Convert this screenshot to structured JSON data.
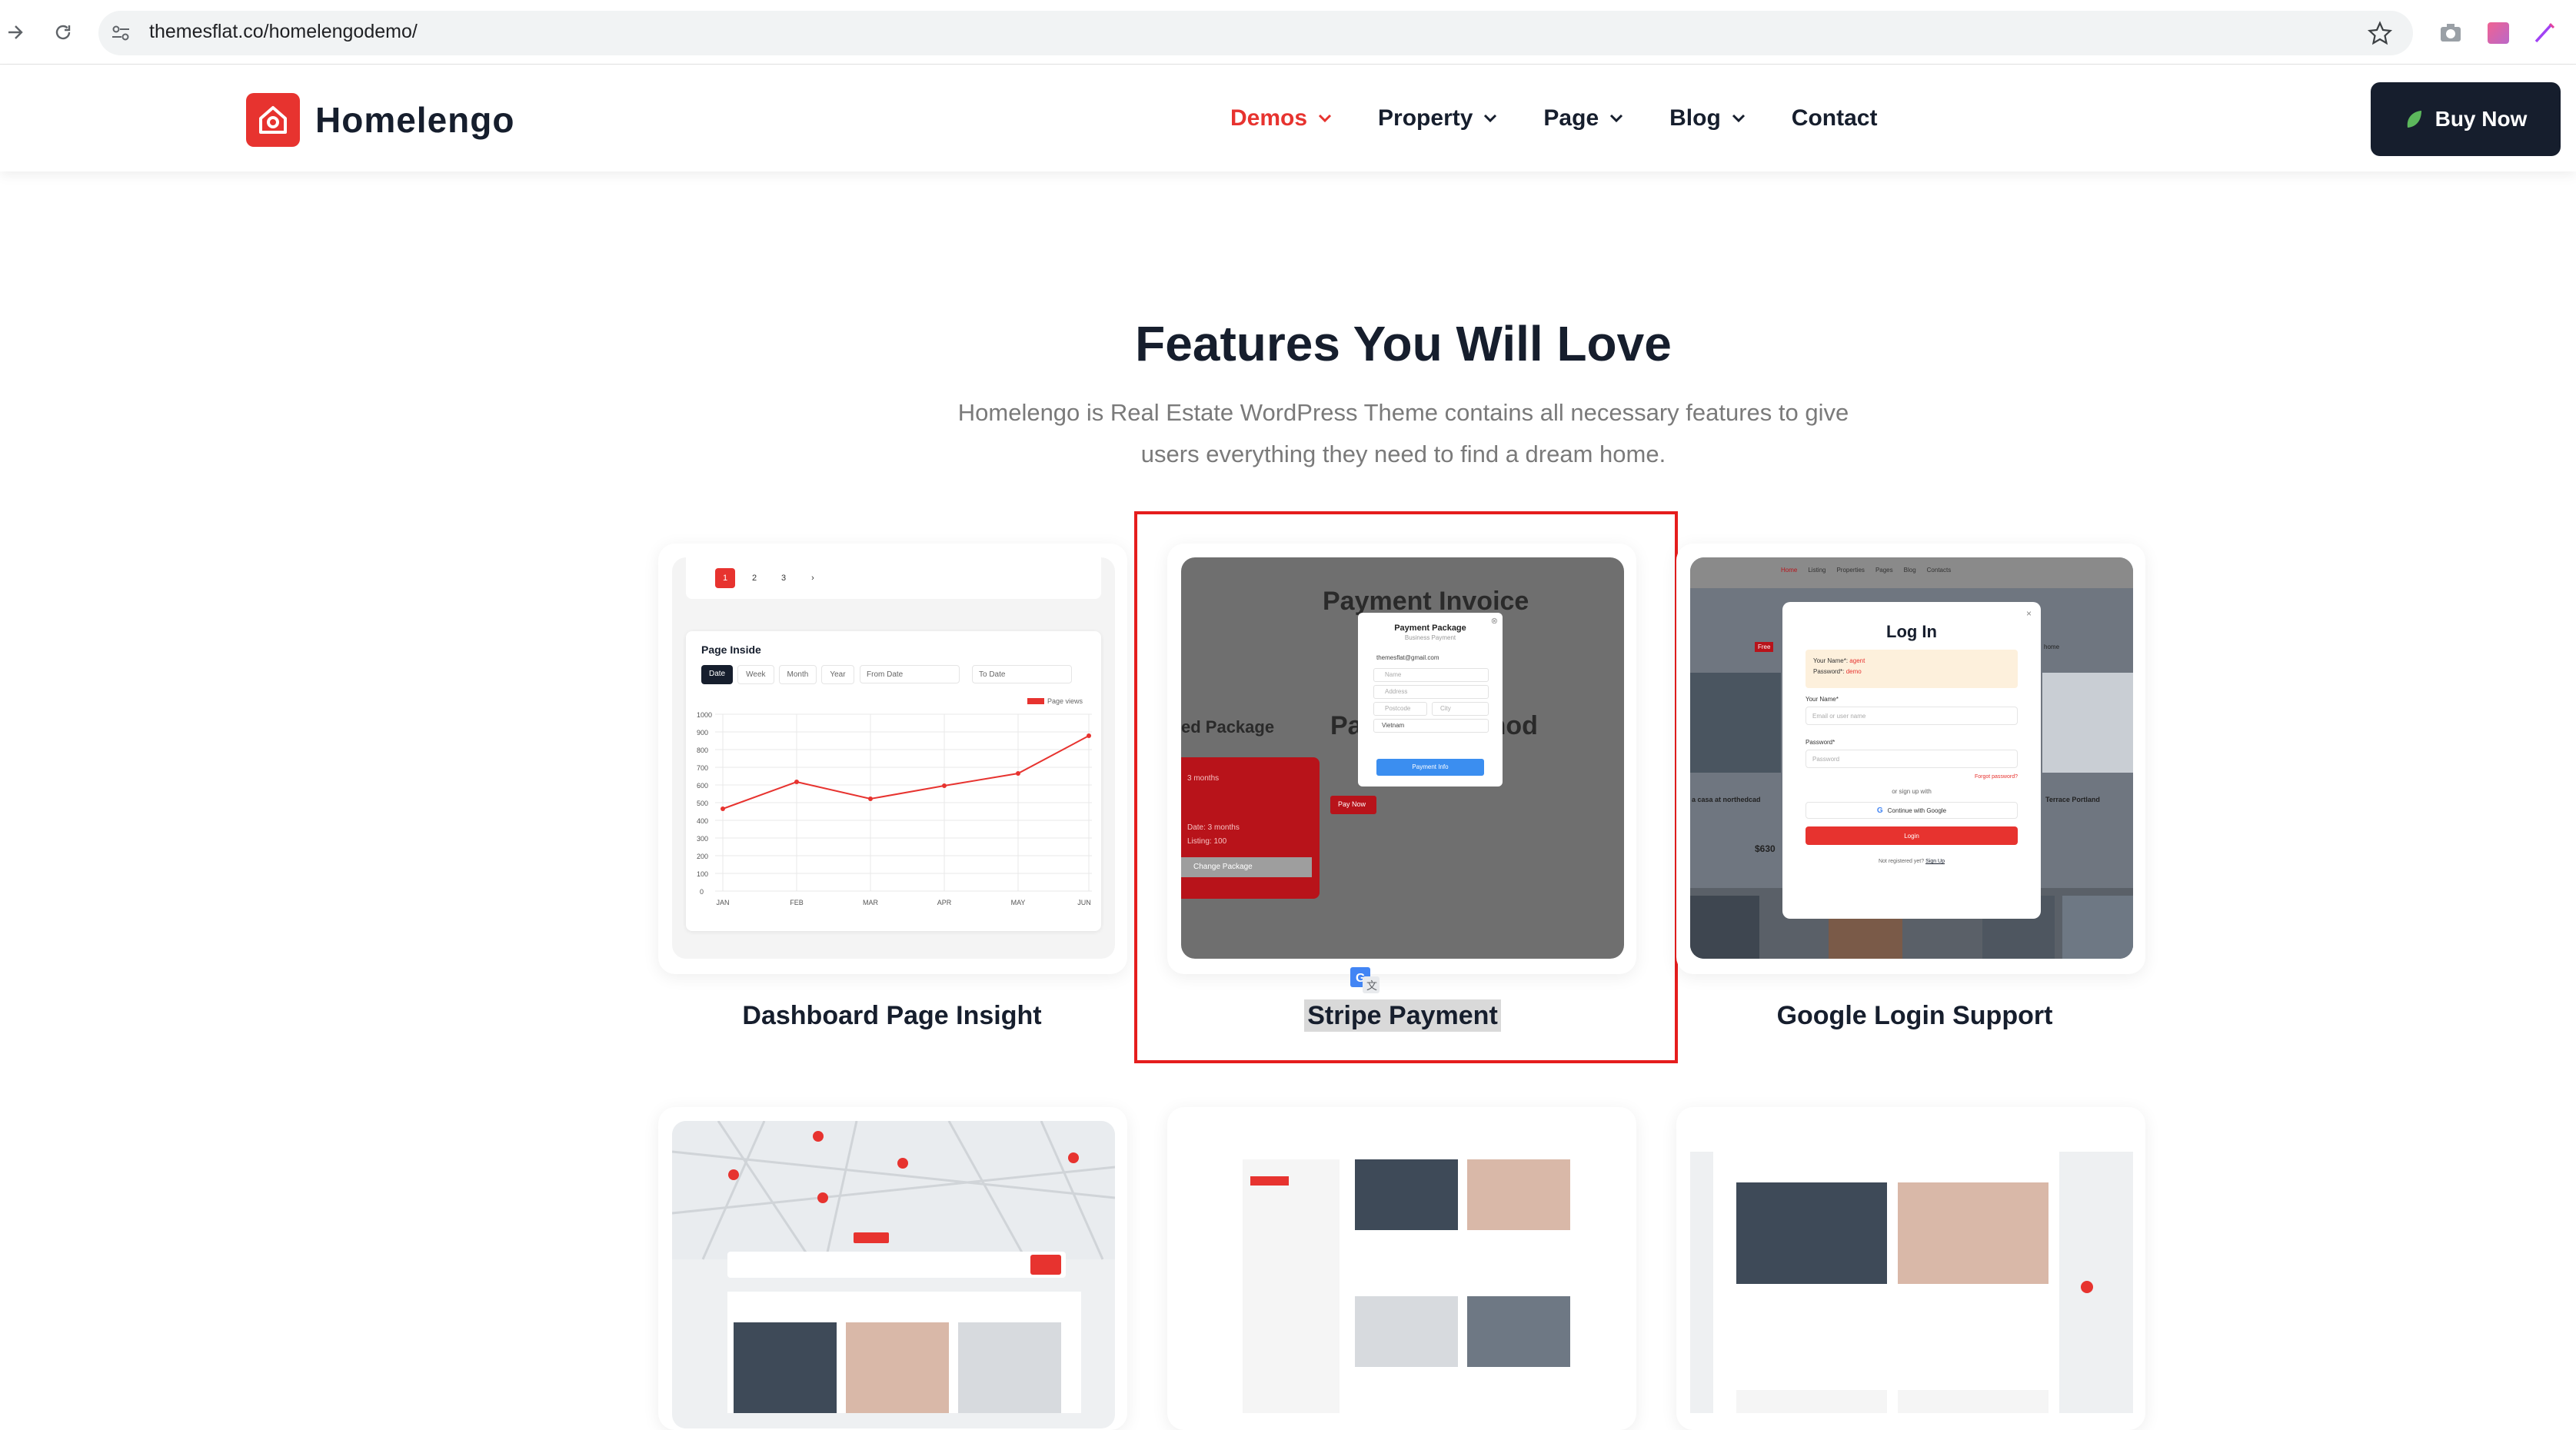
{
  "browser": {
    "url": "themesflat.co/homelengodemo/"
  },
  "header": {
    "logo_text": "Homelengo",
    "nav": [
      {
        "label": "Demos",
        "active": true,
        "has_dropdown": true
      },
      {
        "label": "Property",
        "active": false,
        "has_dropdown": true
      },
      {
        "label": "Page",
        "active": false,
        "has_dropdown": true
      },
      {
        "label": "Blog",
        "active": false,
        "has_dropdown": true
      },
      {
        "label": "Contact",
        "active": false,
        "has_dropdown": false
      }
    ],
    "buy_now_label": "Buy Now"
  },
  "section": {
    "title": "Features You Will Love",
    "subtitle_line1": "Homelengo is Real Estate WordPress Theme contains all necessary features to give",
    "subtitle_line2": "users everything they need to find a dream home."
  },
  "features": [
    {
      "label": "Dashboard Page Insight"
    },
    {
      "label": "Stripe Payment",
      "selected": true
    },
    {
      "label": "Google Login Support"
    }
  ],
  "dashboard_shot": {
    "pages": [
      "1",
      "2",
      "3",
      "›"
    ],
    "panel_title": "Page Inside",
    "tabs": [
      "Date",
      "Week",
      "Month",
      "Year"
    ],
    "from_date": "From Date",
    "to_date": "To Date",
    "legend": "Page views",
    "y_ticks": [
      "1000",
      "900",
      "800",
      "700",
      "600",
      "500",
      "400",
      "300",
      "200",
      "100",
      "0"
    ],
    "months": [
      "JAN",
      "FEB",
      "MAR",
      "APR",
      "MAY",
      "JUN"
    ]
  },
  "payment_shot": {
    "bg_title": "Payment Invoice",
    "bg_left": "ed Package",
    "bg_method_a": "Pa",
    "bg_method_b": "hod",
    "bg_months": "3 months",
    "bg_date": "Date: 3 months",
    "bg_listing": "Listing: 100",
    "bg_change": "Change Package",
    "bg_pay": "Pay Now",
    "modal_title": "Payment Package",
    "modal_sub": "Business Payment",
    "email": "themesflat@gmail.com",
    "name_ph": "Name",
    "address_ph": "Address",
    "postcode_ph": "Postcode",
    "city_ph": "City",
    "country": "Vietnam",
    "button": "Payment Info"
  },
  "login_shot": {
    "nav": [
      "Home",
      "Listing",
      "Properties",
      "Pages",
      "Blog",
      "Contacts"
    ],
    "title": "Log In",
    "demo_user_label": "Your Name*:",
    "demo_user": "agent",
    "demo_pass_label": "Password*:",
    "demo_pass": "demo",
    "username_label": "Your Name*",
    "username_ph": "Email or user name",
    "password_label": "Password*",
    "password_ph": "Password",
    "forgot": "Forgot password?",
    "or_signup": "or sign up with",
    "google": "Continue with Google",
    "login_btn": "Login",
    "not_registered": "Not registered yet?",
    "signup": "Sign Up",
    "left_caption": "a casa at northedcad",
    "right_caption": "Terrace Portland",
    "price_left": "$630",
    "tag_left": "Free",
    "home_right": "home"
  },
  "colors": {
    "brand_red": "#e7332f",
    "dark": "#161e2d",
    "muted": "#7a7a7a",
    "highlight_border": "#e51d1d",
    "stripe_blue": "#3b8ef0"
  }
}
